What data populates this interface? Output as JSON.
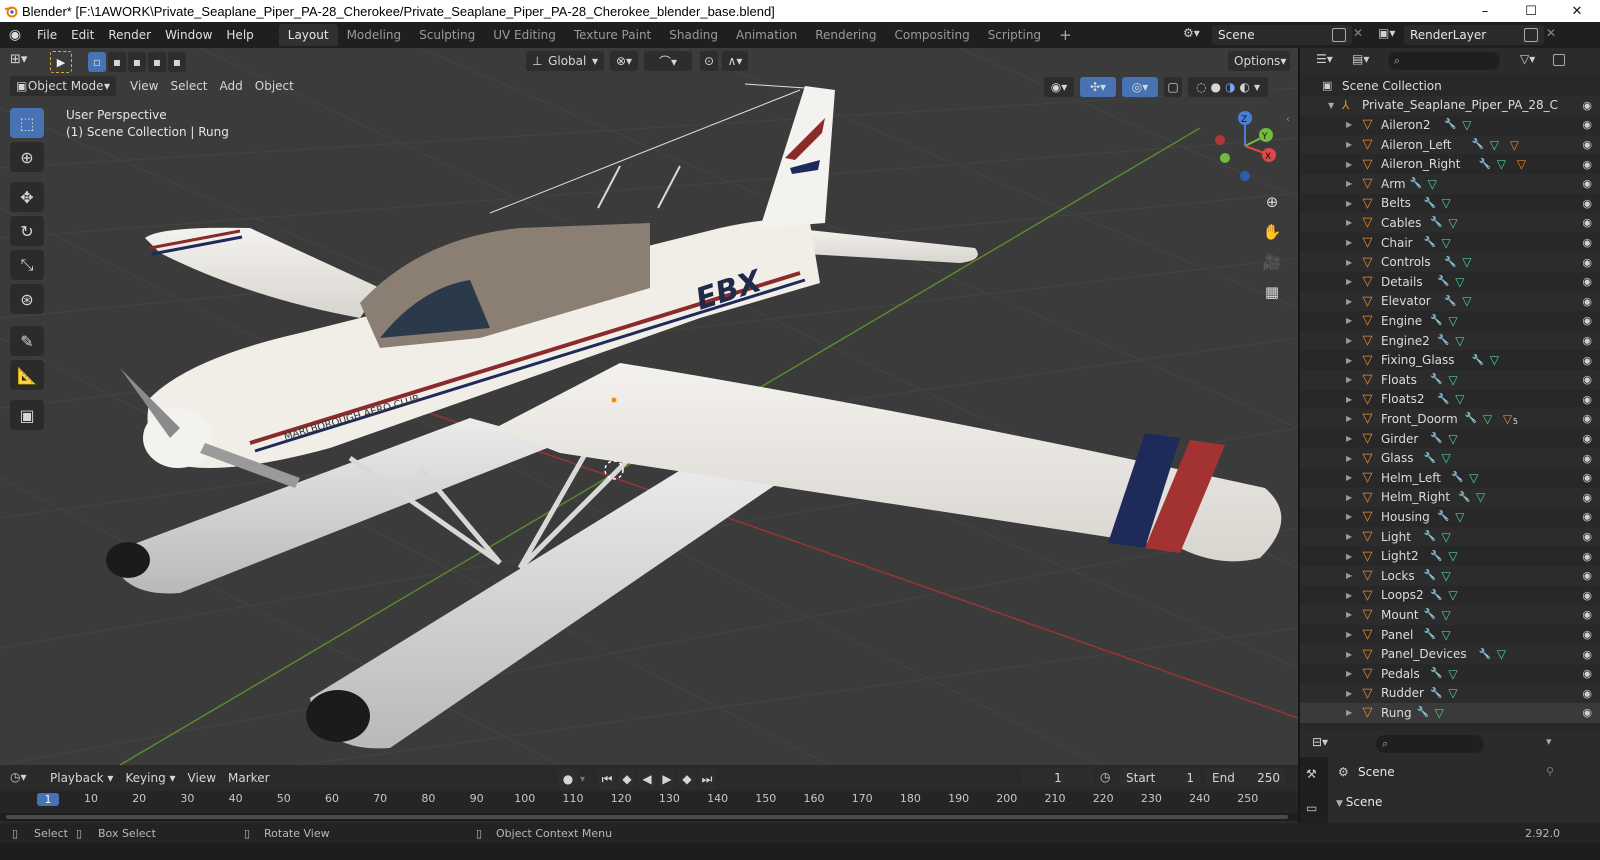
{
  "window": {
    "title": "Blender* [F:\\1AWORK\\Private_Seaplane_Piper_PA-28_Cherokee/Private_Seaplane_Piper_PA-28_Cherokee_blender_base.blend]",
    "minimize": "–",
    "maximize": "☐",
    "close": "✕"
  },
  "menu": [
    "File",
    "Edit",
    "Render",
    "Window",
    "Help"
  ],
  "workspaces": [
    {
      "label": "Layout",
      "active": true
    },
    {
      "label": "Modeling"
    },
    {
      "label": "Sculpting"
    },
    {
      "label": "UV Editing"
    },
    {
      "label": "Texture Paint"
    },
    {
      "label": "Shading"
    },
    {
      "label": "Animation"
    },
    {
      "label": "Rendering"
    },
    {
      "label": "Compositing"
    },
    {
      "label": "Scripting"
    }
  ],
  "add_workspace": "+",
  "scene_name": "Scene",
  "render_layer": "RenderLayer",
  "tool_settings": {
    "orientation": "Global",
    "options": "Options"
  },
  "viewport": {
    "mode": "Object Mode",
    "menus": [
      "View",
      "Select",
      "Add",
      "Object"
    ],
    "perspective": "User Perspective",
    "collection_info": "(1) Scene Collection | Rung",
    "gizmo": {
      "x": "X",
      "y": "Y",
      "z": "Z"
    }
  },
  "outliner": {
    "search_placeholder": "",
    "scene_collection": "Scene Collection",
    "root": "Private_Seaplane_Piper_PA_28_C",
    "items": [
      "Aileron2",
      "Aileron_Left",
      "Aileron_Right",
      "Arm",
      "Belts",
      "Cables",
      "Chair",
      "Controls",
      "Details",
      "Elevator",
      "Engine",
      "Engine2",
      "Fixing_Glass",
      "Floats",
      "Floats2",
      "Front_Doorm",
      "Girder",
      "Glass",
      "Helm_Left",
      "Helm_Right",
      "Housing",
      "Light",
      "Light2",
      "Locks",
      "Loops2",
      "Mount",
      "Panel",
      "Panel_Devices",
      "Pedals",
      "Rudder",
      "Rung"
    ],
    "front_doorm_badge": "5"
  },
  "properties": {
    "tab_scene": "Scene",
    "panel_scene": "Scene"
  },
  "timeline": {
    "menus": [
      "Playback",
      "Keying",
      "View",
      "Marker"
    ],
    "current_frame": "1",
    "start_label": "Start",
    "start": "1",
    "end_label": "End",
    "end": "250",
    "ticks": [
      "1",
      "10",
      "20",
      "30",
      "40",
      "50",
      "60",
      "70",
      "80",
      "90",
      "100",
      "110",
      "120",
      "130",
      "140",
      "150",
      "160",
      "170",
      "180",
      "190",
      "200",
      "210",
      "220",
      "230",
      "240",
      "250"
    ]
  },
  "statusbar": {
    "select": "Select",
    "box_select": "Box Select",
    "rotate_view": "Rotate View",
    "context_menu": "Object Context Menu",
    "version": "2.92.0"
  },
  "aircraft_text": {
    "registration": "EBX",
    "club": "MARLBOROUGH AERO CLUB"
  },
  "colors": {
    "accent_blue": "#4772b3",
    "object_orange": "#ed8a2c",
    "modifier_blue": "#6fa8dc",
    "mesh_green": "#4bd0a0",
    "grid_green": "#5a8a2a",
    "grid_red": "#9a3434"
  }
}
